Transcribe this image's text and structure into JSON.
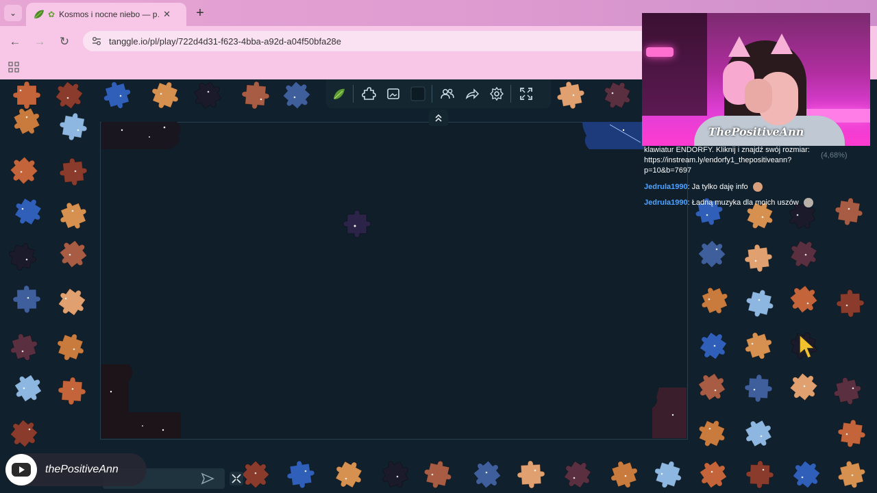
{
  "browser": {
    "tab_title": "Kosmos i nocne niebo — p…",
    "tab_close": "✕",
    "new_tab": "+",
    "url": "tanggle.io/pl/play/722d4d31-f623-4bba-a92d-a04f50bfa28e",
    "nav": {
      "back": "←",
      "forward": "→",
      "reload": "↻"
    }
  },
  "webcam": {
    "caption": "ThePositiveAnn"
  },
  "chat": {
    "lines": [
      {
        "text": "klawiatur ENDORFY. Kliknij i znajdź swój rozmiar:"
      },
      {
        "text": "https://instream.ly/endorfy1_thepositiveann?"
      },
      {
        "text": "p=10&b=7697"
      },
      {
        "user": "Jedrula1990",
        "text": "Ja tylko daję info"
      },
      {
        "user": "Jedrula1990",
        "text": "Ładną muzyka dla moich uszów"
      }
    ],
    "faded_percent": "(4,68%)"
  },
  "channel": {
    "name": "thePositiveAnn"
  },
  "colors": {
    "background": "#10202c",
    "board_border": "#26404f",
    "tab_pink": "#f8c6e7",
    "chat_user": "#4fa3ff"
  }
}
